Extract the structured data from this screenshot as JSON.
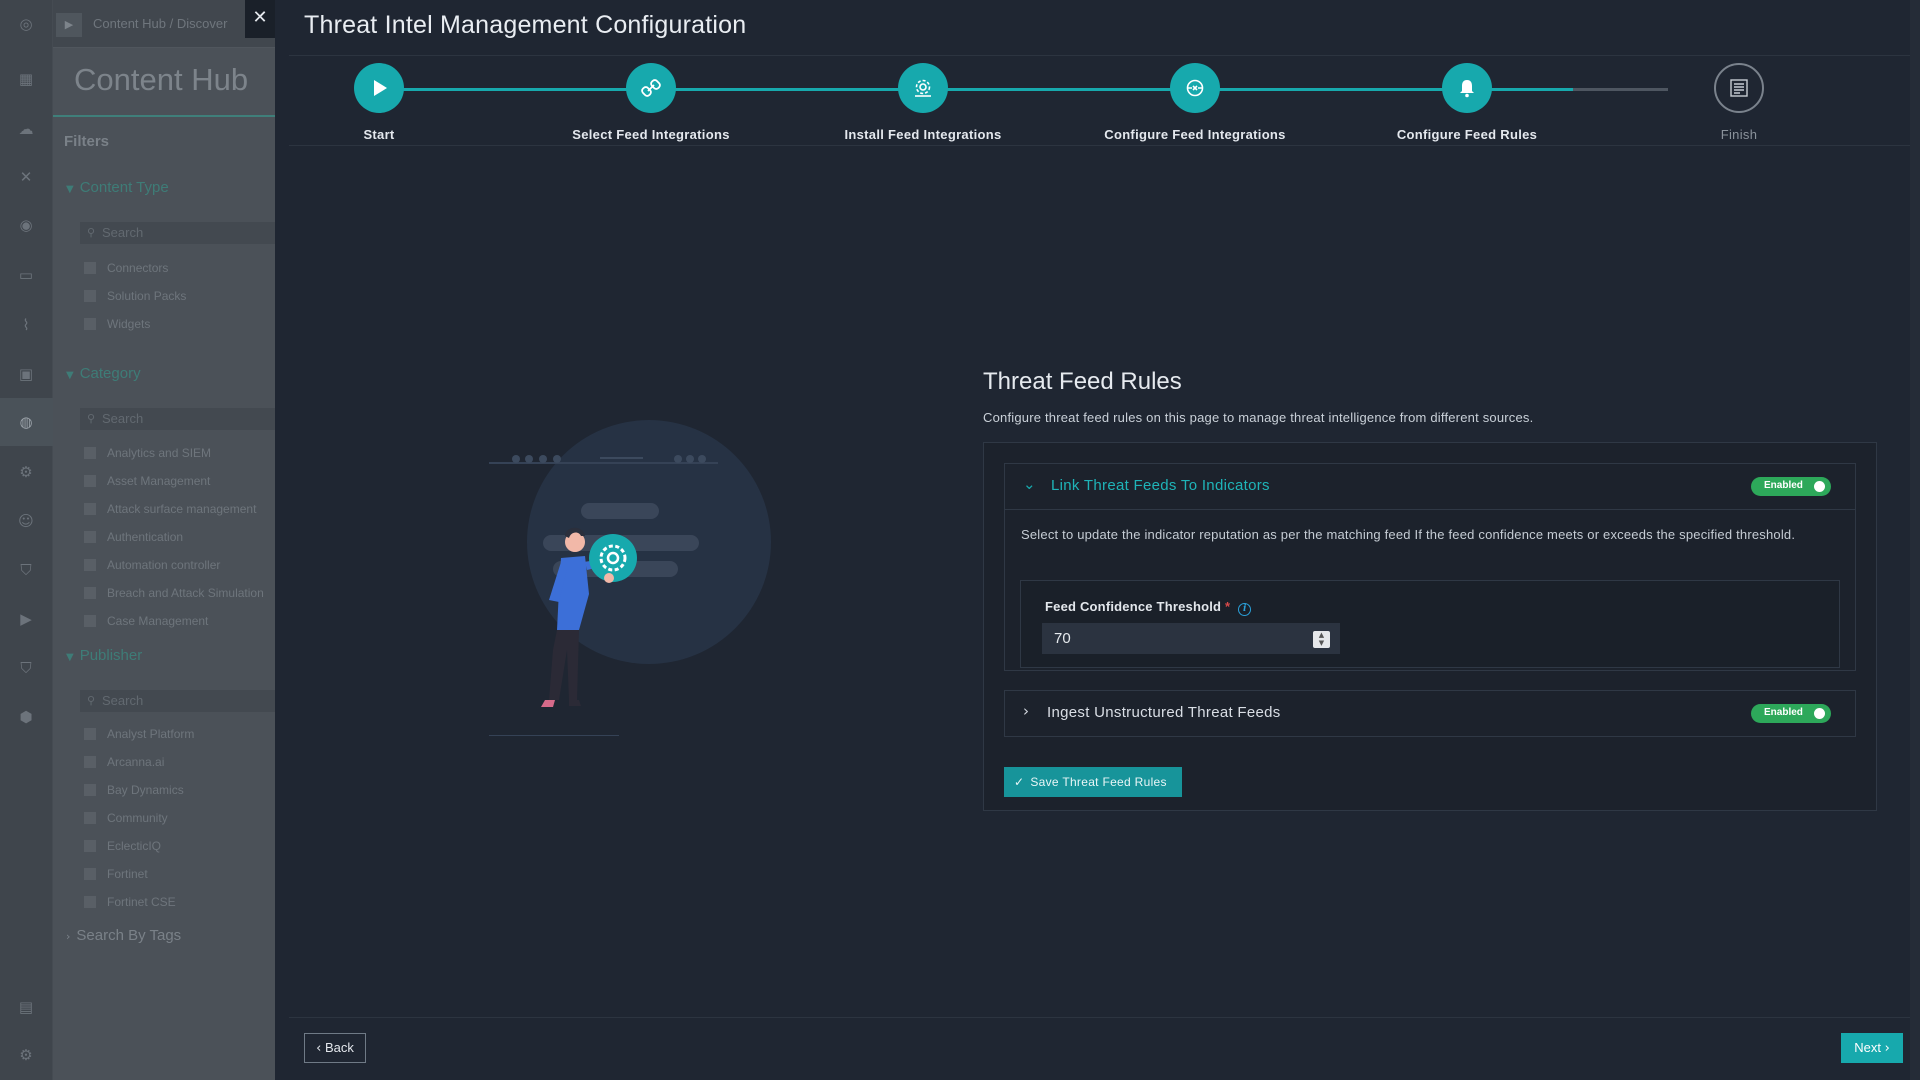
{
  "background": {
    "breadcrumb": "Content Hub /  Discover",
    "title": "Content Hub",
    "filters_label": "Filters",
    "content_type": {
      "label": "Content Type",
      "search_placeholder": "Search",
      "items": [
        "Connectors",
        "Solution Packs",
        "Widgets"
      ]
    },
    "category": {
      "label": "Category",
      "search_placeholder": "Search",
      "items": [
        "Analytics and SIEM",
        "Asset Management",
        "Attack surface management",
        "Authentication",
        "Automation controller",
        "Breach and Attack Simulation",
        "Case Management"
      ]
    },
    "publisher": {
      "label": "Publisher",
      "search_placeholder": "Search",
      "items": [
        "Analyst Platform",
        "Arcanna.ai",
        "Bay Dynamics",
        "Community",
        "EclecticIQ",
        "Fortinet",
        "Fortinet CSE"
      ]
    },
    "tags_label": "Search By Tags"
  },
  "modal": {
    "title": "Threat Intel Management Configuration",
    "close_icon": "close-icon",
    "steps": [
      {
        "label": "Start",
        "icon": "play-icon",
        "status": "done"
      },
      {
        "label": "Select Feed Integrations",
        "icon": "link-icon",
        "status": "done"
      },
      {
        "label": "Install Feed Integrations",
        "icon": "install-gear-icon",
        "status": "done"
      },
      {
        "label": "Configure Feed Integrations",
        "icon": "configure-icon",
        "status": "done"
      },
      {
        "label": "Configure Feed Rules",
        "icon": "bell-icon",
        "status": "current"
      },
      {
        "label": "Finish",
        "icon": "checklist-icon",
        "status": "pending"
      }
    ],
    "accent_color": "#17a9ad",
    "content": {
      "title": "Threat Feed Rules",
      "description": "Configure threat feed rules on this page to manage threat intelligence from different sources.",
      "rules": [
        {
          "title": "Link Threat Feeds To Indicators",
          "toggle": "Enabled",
          "expanded": true,
          "description": "Select to update the indicator reputation as per the matching feed If the feed confidence meets or exceeds the specified threshold.",
          "field": {
            "label": "Feed Confidence Threshold",
            "required_mark": "*",
            "value": "70"
          }
        },
        {
          "title": "Ingest Unstructured Threat Feeds",
          "toggle": "Enabled",
          "expanded": false
        }
      ],
      "save_label": "Save Threat Feed Rules"
    },
    "footer": {
      "back_label": "Back",
      "next_label": "Next"
    }
  }
}
